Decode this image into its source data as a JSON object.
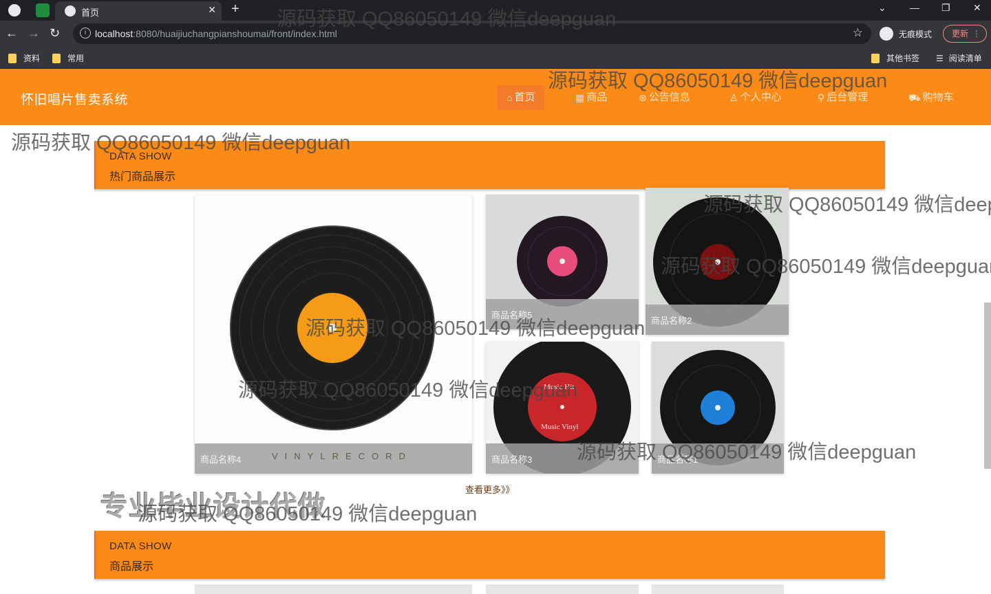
{
  "browser": {
    "tab_title": "首页",
    "url_host": "localhost",
    "url_rest": ":8080/huaijiuchangpianshoumai/front/index.html",
    "incognito_label": "无痕模式",
    "update_label": "更新",
    "bookmarks": [
      "资料",
      "常用"
    ],
    "bookmarks_right": [
      "其他书签",
      "阅读清单"
    ]
  },
  "site": {
    "title": "怀旧唱片售卖系统",
    "menu": [
      {
        "icon": "⌂",
        "label": "首页"
      },
      {
        "icon": "▦",
        "label": "商品"
      },
      {
        "icon": "⊛",
        "label": "公告信息"
      },
      {
        "icon": "♙",
        "label": "个人中心"
      },
      {
        "icon": "⚲",
        "label": "后台管理"
      },
      {
        "icon": "⛟",
        "label": "购物车"
      }
    ]
  },
  "sections": [
    {
      "en": "DATA SHOW",
      "zh": "热门商品展示"
    },
    {
      "en": "DATA SHOW",
      "zh": "商品展示"
    }
  ],
  "products": [
    {
      "name": "商品名称4",
      "overlay": "VINYLRECORD"
    },
    {
      "name": "商品名称5",
      "label_text": ""
    },
    {
      "name": "商品名称2",
      "label_text": ""
    },
    {
      "name": "商品名称3",
      "label_text": "Music Hit",
      "label_text2": "Music Vinyl"
    },
    {
      "name": "商品名称1"
    }
  ],
  "more_label": "查看更多》》",
  "promo_text": "专业毕业设计代做",
  "watermark": "源码获取 QQ86050149 微信deepguan",
  "colors": {
    "brand": "#fc8a16",
    "brand_dark": "#f47b2a"
  }
}
